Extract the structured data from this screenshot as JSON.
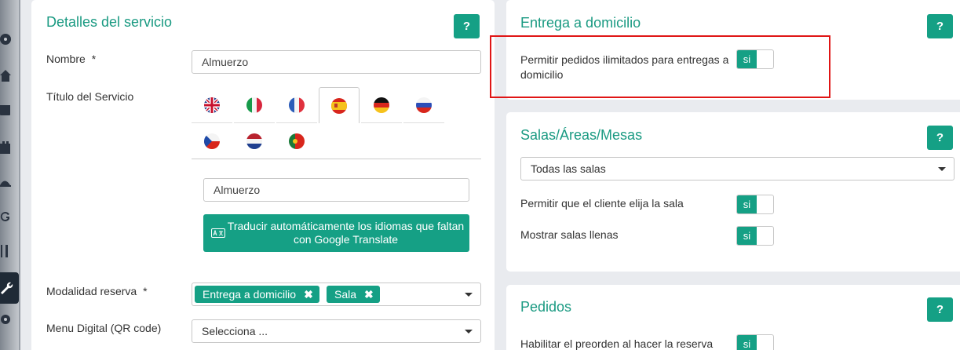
{
  "service_details": {
    "title": "Detalles del servicio",
    "help_label": "?",
    "name_label": "Nombre",
    "name_required": "*",
    "name_value": "Almuerzo",
    "service_title_label": "Título del Servicio",
    "languages": [
      {
        "flag": "uk-flag-icon"
      },
      {
        "flag": "italy-flag-icon"
      },
      {
        "flag": "france-flag-icon"
      },
      {
        "flag": "spain-flag-icon",
        "active": true
      },
      {
        "flag": "germany-flag-icon"
      },
      {
        "flag": "russia-flag-icon"
      },
      {
        "flag": "czech-flag-icon"
      },
      {
        "flag": "netherlands-flag-icon"
      },
      {
        "flag": "portugal-flag-icon"
      }
    ],
    "title_value": "Almuerzo",
    "translate_button": "Traducir automáticamente los idiomas que faltan con Google Translate",
    "booking_mode_label": "Modalidad reserva",
    "booking_mode_required": "*",
    "booking_mode_tags": [
      "Entrega a domicilio",
      "Sala"
    ],
    "digital_menu_label": "Menu Digital (QR code)",
    "digital_menu_value": "Selecciona ..."
  },
  "delivery": {
    "title": "Entrega a domicilio",
    "help_label": "?",
    "unlimited_label_line1": "Permitir pedidos ilimitados para entregas a",
    "unlimited_label_line2": "domicilio",
    "unlimited_toggle": "si"
  },
  "rooms": {
    "title": "Salas/Áreas/Mesas",
    "help_label": "?",
    "select_value": "Todas las salas",
    "choose_room_label": "Permitir que el cliente elija la sala",
    "choose_room_toggle": "si",
    "show_full_label": "Mostrar salas llenas",
    "show_full_toggle": "si"
  },
  "orders": {
    "title": "Pedidos",
    "help_label": "?",
    "preorder_label": "Habilitar el preorden al hacer la reserva",
    "preorder_toggle": "si"
  },
  "colors": {
    "accent": "#15a085",
    "title": "#1a9a82",
    "highlight": "#e01515"
  }
}
